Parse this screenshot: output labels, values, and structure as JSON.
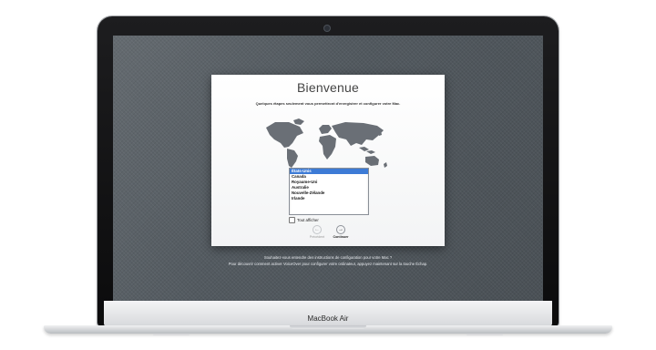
{
  "setup": {
    "title": "Bienvenue",
    "subtitle": "Quelques étapes seulement vous permettront d'enregistrer et configurer votre Mac.",
    "countries": [
      "États-Unis",
      "Canada",
      "Royaume-Uni",
      "Australie",
      "Nouvelle-Zélande",
      "Irlande"
    ],
    "selected_country": "États-Unis",
    "show_all_label": "Tout afficher",
    "show_all_checked": false,
    "prev_label": "Précédent",
    "next_label": "Continuer",
    "voiceover_line1": "Souhaitez-vous entendre des instructions de configuration pour votre Mac ?",
    "voiceover_line2": "Pour découvrir comment activer VoiceOver pour configurer votre ordinateur, appuyez maintenant sur la touche Échap."
  },
  "laptop": {
    "brand": "MacBook Air"
  },
  "colors": {
    "screen_bg": "#535a60",
    "selection": "#3d7bd6"
  },
  "icons": {
    "previous": "left-arrow-circle-icon",
    "next": "right-arrow-circle-icon",
    "camera": "camera-dot-icon"
  }
}
